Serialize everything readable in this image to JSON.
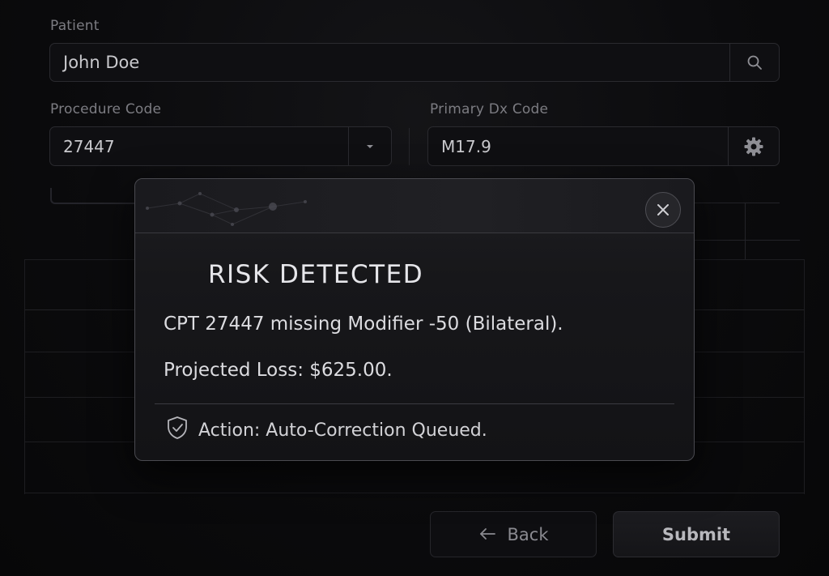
{
  "form": {
    "patient_label": "Patient",
    "patient_value": "John Doe",
    "procedure_label": "Procedure Code",
    "procedure_value": "27447",
    "dx_label": "Primary Dx Code",
    "dx_value": "M17.9"
  },
  "icons": {
    "search": "search-icon",
    "dropdown": "chevron-down-icon",
    "settings": "gear-icon",
    "close": "close-icon",
    "shield": "shield-check-icon",
    "back_arrow": "arrow-left-icon"
  },
  "alert": {
    "title": "RISK DETECTED",
    "message": "CPT 27447 missing Modifier -50 (Bilateral).",
    "loss": "Projected Loss: $625.00.",
    "action": "Action: Auto-Correction Queued."
  },
  "footer": {
    "back_label": "Back",
    "submit_label": "Submit"
  },
  "colors": {
    "background": "#0a0a0c",
    "modal_border": "#4a4a50",
    "text": "#dcdce0"
  }
}
